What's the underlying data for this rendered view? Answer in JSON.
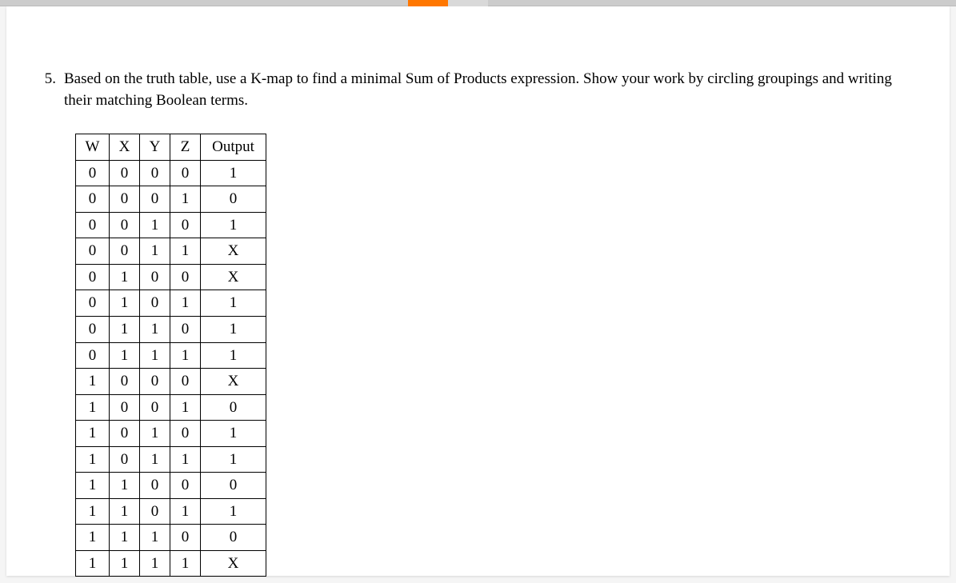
{
  "question": {
    "number": "5.",
    "text": "Based on the truth table, use a K-map to find a minimal Sum of Products expression. Show your work by circling groupings and writing their matching Boolean terms."
  },
  "table": {
    "headers": {
      "w": "W",
      "x": "X",
      "y": "Y",
      "z": "Z",
      "out": "Output"
    },
    "rows": [
      {
        "w": "0",
        "x": "0",
        "y": "0",
        "z": "0",
        "out": "1"
      },
      {
        "w": "0",
        "x": "0",
        "y": "0",
        "z": "1",
        "out": "0"
      },
      {
        "w": "0",
        "x": "0",
        "y": "1",
        "z": "0",
        "out": "1"
      },
      {
        "w": "0",
        "x": "0",
        "y": "1",
        "z": "1",
        "out": "X"
      },
      {
        "w": "0",
        "x": "1",
        "y": "0",
        "z": "0",
        "out": "X"
      },
      {
        "w": "0",
        "x": "1",
        "y": "0",
        "z": "1",
        "out": "1"
      },
      {
        "w": "0",
        "x": "1",
        "y": "1",
        "z": "0",
        "out": "1"
      },
      {
        "w": "0",
        "x": "1",
        "y": "1",
        "z": "1",
        "out": "1"
      },
      {
        "w": "1",
        "x": "0",
        "y": "0",
        "z": "0",
        "out": "X"
      },
      {
        "w": "1",
        "x": "0",
        "y": "0",
        "z": "1",
        "out": "0"
      },
      {
        "w": "1",
        "x": "0",
        "y": "1",
        "z": "0",
        "out": "1"
      },
      {
        "w": "1",
        "x": "0",
        "y": "1",
        "z": "1",
        "out": "1"
      },
      {
        "w": "1",
        "x": "1",
        "y": "0",
        "z": "0",
        "out": "0"
      },
      {
        "w": "1",
        "x": "1",
        "y": "0",
        "z": "1",
        "out": "1"
      },
      {
        "w": "1",
        "x": "1",
        "y": "1",
        "z": "0",
        "out": "0"
      },
      {
        "w": "1",
        "x": "1",
        "y": "1",
        "z": "1",
        "out": "X"
      }
    ]
  }
}
